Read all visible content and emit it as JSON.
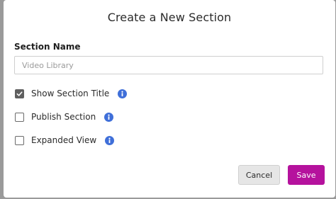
{
  "modal": {
    "title": "Create a New Section",
    "section_name": {
      "label": "Section Name",
      "placeholder": "Video Library",
      "value": ""
    },
    "options": [
      {
        "label": "Show Section Title",
        "checked": true,
        "info_icon": "info-icon"
      },
      {
        "label": "Publish Section",
        "checked": false,
        "info_icon": "info-icon"
      },
      {
        "label": "Expanded View",
        "checked": false,
        "info_icon": "info-icon"
      }
    ],
    "buttons": {
      "cancel_label": "Cancel",
      "save_label": "Save"
    }
  },
  "colors": {
    "accent": "#b5129d",
    "info": "#3f6fd9",
    "checkbox_checked": "#5f5f5f",
    "overlay": "#9a9a9a"
  }
}
